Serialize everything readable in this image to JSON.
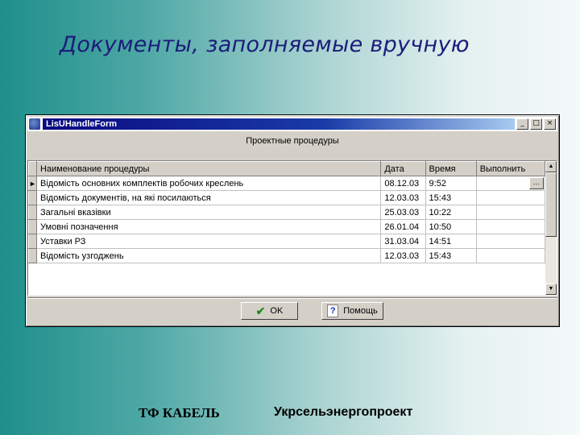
{
  "slide": {
    "title": "Документы, заполняемые вручную"
  },
  "window": {
    "title": "LisUHandleForm",
    "controls": {
      "minimize": "_",
      "maximize": "□",
      "close": "×"
    },
    "caption": "Проектные процедуры"
  },
  "table": {
    "columns": [
      "Наименование процедуры",
      "Дата",
      "Время",
      "Выполнить"
    ],
    "rows": [
      {
        "name": "Відомість основних комплектів робочих креслень",
        "date": "08.12.03",
        "time": "9:52",
        "exec": ""
      },
      {
        "name": "Відомість документів, на які посилаються",
        "date": "12.03.03",
        "time": "15:43",
        "exec": ""
      },
      {
        "name": "Загальні вказівки",
        "date": "25.03.03",
        "time": "10:22",
        "exec": ""
      },
      {
        "name": "Умовні позначення",
        "date": "26.01.04",
        "time": "10:50",
        "exec": ""
      },
      {
        "name": "Уставки РЗ",
        "date": "31.03.04",
        "time": "14:51",
        "exec": ""
      },
      {
        "name": "Відомість узгоджень",
        "date": "12.03.03",
        "time": "15:43",
        "exec": ""
      }
    ],
    "current_row_marker": "►",
    "ellipsis": "…"
  },
  "buttons": {
    "ok": "OK",
    "help": "Помощь"
  },
  "footer": {
    "left": "ТФ КАБЕЛЬ",
    "right": "Укрсельэнергопроект"
  },
  "colors": {
    "title": "#1c1c7a",
    "titlebar": "#0a0a80",
    "check": "#1e8c1e"
  }
}
